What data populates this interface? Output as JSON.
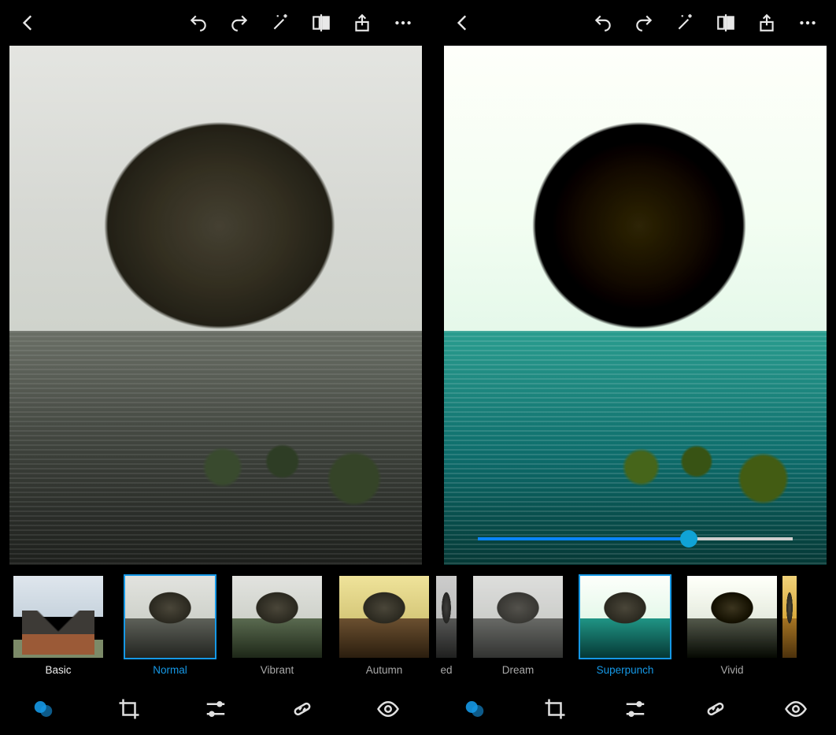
{
  "left_pane": {
    "toolbar_icons": [
      "back",
      "undo",
      "redo",
      "auto-enhance",
      "compare",
      "share",
      "more"
    ],
    "active_filter": "Normal",
    "filters": {
      "category_label": "Basic",
      "items": [
        {
          "id": "normal",
          "label": "Normal",
          "selected": true
        },
        {
          "id": "vibrant",
          "label": "Vibrant",
          "selected": false
        },
        {
          "id": "autumn",
          "label": "Autumn",
          "selected": false
        }
      ]
    },
    "tools": [
      "looks",
      "crop",
      "adjust",
      "heal",
      "redeye"
    ],
    "active_tool": "looks"
  },
  "right_pane": {
    "toolbar_icons": [
      "back",
      "undo",
      "redo",
      "auto-enhance",
      "compare",
      "share",
      "more"
    ],
    "active_filter": "Superpunch",
    "intensity_percent": 67,
    "filters": {
      "items": [
        {
          "id": "partial",
          "label": "ed",
          "selected": false
        },
        {
          "id": "dream",
          "label": "Dream",
          "selected": false
        },
        {
          "id": "superpunch",
          "label": "Superpunch",
          "selected": true
        },
        {
          "id": "vivid",
          "label": "Vivid",
          "selected": false
        },
        {
          "id": "warm_partial",
          "label": "",
          "selected": false
        }
      ]
    },
    "tools": [
      "looks",
      "crop",
      "adjust",
      "heal",
      "redeye"
    ],
    "active_tool": "looks"
  },
  "colors": {
    "accent": "#1598e6"
  }
}
